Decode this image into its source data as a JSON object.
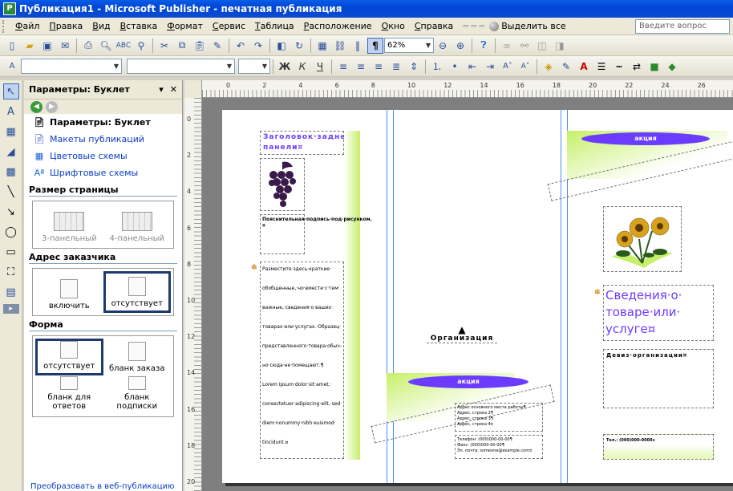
{
  "window": {
    "title": "Публикация1 - Microsoft Publisher - печатная публикация"
  },
  "menu": {
    "items": [
      "Файл",
      "Правка",
      "Вид",
      "Вставка",
      "Формат",
      "Сервис",
      "Таблица",
      "Расположение",
      "Окно",
      "Справка"
    ],
    "select_all": "Выделить все",
    "help_placeholder": "Введите вопрос"
  },
  "toolbar": {
    "zoom": "62%"
  },
  "task_pane": {
    "title": "Параметры: Буклет",
    "links": [
      {
        "label": "Параметры: Буклет",
        "icon": "brochure-icon"
      },
      {
        "label": "Макеты публикаций",
        "icon": "layouts-icon"
      },
      {
        "label": "Цветовые схемы",
        "icon": "color-scheme-icon"
      },
      {
        "label": "Шрифтовые схемы",
        "icon": "font-scheme-icon"
      }
    ],
    "page_size": {
      "heading": "Размер страницы",
      "options": [
        "3-панельный",
        "4-панельный"
      ]
    },
    "customer_address": {
      "heading": "Адрес заказчика",
      "options": [
        "включить",
        "отсутствует"
      ]
    },
    "form": {
      "heading": "Форма",
      "options": [
        "отсутствует",
        "бланк заказа",
        "бланк для ответов",
        "бланк подписки"
      ]
    },
    "footer_link": "Преобразовать в веб-публикацию"
  },
  "document": {
    "back_panel_title": "Заголовок·задней· панели¤",
    "caption": "Пояснительная·подпись·под·рисунком.¤",
    "body_lines": [
      "Разместите·здесь·краткие·",
      "обобщенные,·но·вместе·с·тем·",
      "важные,·сведения·о·ваших·",
      "товарах·или·услугах.·Образец·",
      "представленного·товара·обыч-",
      "но·сюда·не·помещают.¶",
      "Lorem·ipsum·dolor·sit·amet,·",
      "consectetuer·adipiscing·elit,·sed·",
      "diem·nonummy·nibh·euismod·",
      "tincidunt.¤"
    ],
    "org_name": "Организация",
    "banner": "акция",
    "address_lines": [
      "Адрес основного места работы¶",
      "Адрес, строка 2¶",
      "Адрес, строка 3¶",
      "Адрес, строка 4¤"
    ],
    "contacts": [
      "Телефон: (000)000-00-00¶",
      "Факс: (000)000-00-00¶",
      "Эл. почта: someone@example.com¤"
    ],
    "product_heading": "Сведения·о· товаре·или· услуге¤",
    "motto": "Девиз·организации¤",
    "phone_right": "Тел.: (000)000-0000¤"
  }
}
